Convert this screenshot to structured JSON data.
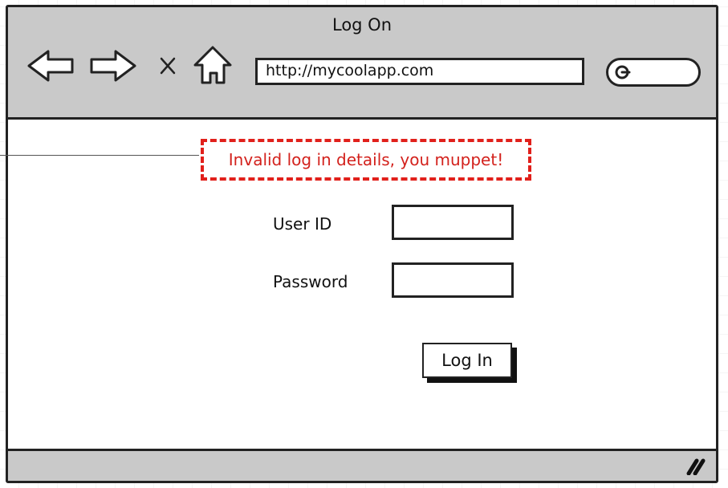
{
  "window": {
    "title": "Log On"
  },
  "toolbar": {
    "icons": [
      "back-arrow-icon",
      "forward-arrow-icon",
      "close-x-icon",
      "home-icon"
    ],
    "address": "http://mycoolapp.com",
    "search_icon": "search-icon"
  },
  "form": {
    "error_message": "Invalid log in details, you muppet!",
    "user_id_label": "User ID",
    "password_label": "Password",
    "login_button": "Log In"
  },
  "colors": {
    "error": "#d3211c",
    "chrome": "#c9c9c9"
  }
}
